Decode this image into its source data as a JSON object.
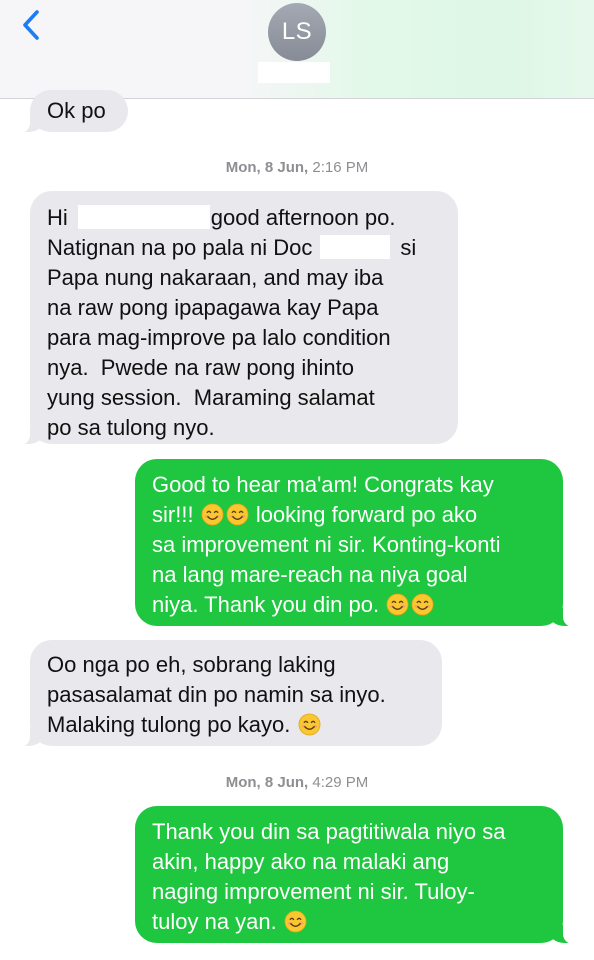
{
  "header": {
    "avatar_initials": "LS",
    "back_icon": "chevron-left-icon"
  },
  "colors": {
    "incoming_bubble": "#e8e8ed",
    "outgoing_bubble": "#1fc63f",
    "accent": "#1c7cf4",
    "avatar": "#8e939c"
  },
  "timestamps": [
    {
      "day": "Mon, 8 Jun,",
      "time": "2:16 PM"
    },
    {
      "day": "Mon, 8 Jun,",
      "time": "4:29 PM"
    }
  ],
  "messages": {
    "m1": {
      "direction": "incoming",
      "lines": [
        "Ok po"
      ]
    },
    "m2": {
      "direction": "incoming",
      "l1a": "Hi",
      "l1b": "good afternoon po.",
      "l2a": "Natignan na po pala ni Doc",
      "l2b": "si",
      "l3": "Papa nung nakaraan, and may iba",
      "l4": "na raw pong ipapagawa kay Papa",
      "l5": "para mag-improve pa lalo condition",
      "l6": "nya.  Pwede na raw pong ihinto",
      "l7": "yung session.  Maraming salamat",
      "l8": "po sa tulong nyo."
    },
    "m3": {
      "direction": "outgoing",
      "l1": "Good to hear ma'am! Congrats kay",
      "l2a": "sir!!!",
      "l2b": "looking forward po ako",
      "l3": "sa improvement ni sir. Konting-konti",
      "l4": "na lang mare-reach na niya goal",
      "l5": "niya. Thank you din po.",
      "emoji": "smiling-face-icon"
    },
    "m4": {
      "direction": "incoming",
      "l1": "Oo nga po eh, sobrang laking",
      "l2": "pasasalamat din po namin sa inyo.",
      "l3": "Malaking tulong po kayo.",
      "emoji": "smiling-face-icon"
    },
    "m5": {
      "direction": "outgoing",
      "l1": "Thank you din sa pagtitiwala niyo sa",
      "l2": "akin, happy ako na malaki ang",
      "l3": "naging improvement ni sir. Tuloy-",
      "l4": "tuloy na yan.",
      "emoji": "smiling-face-icon"
    }
  }
}
